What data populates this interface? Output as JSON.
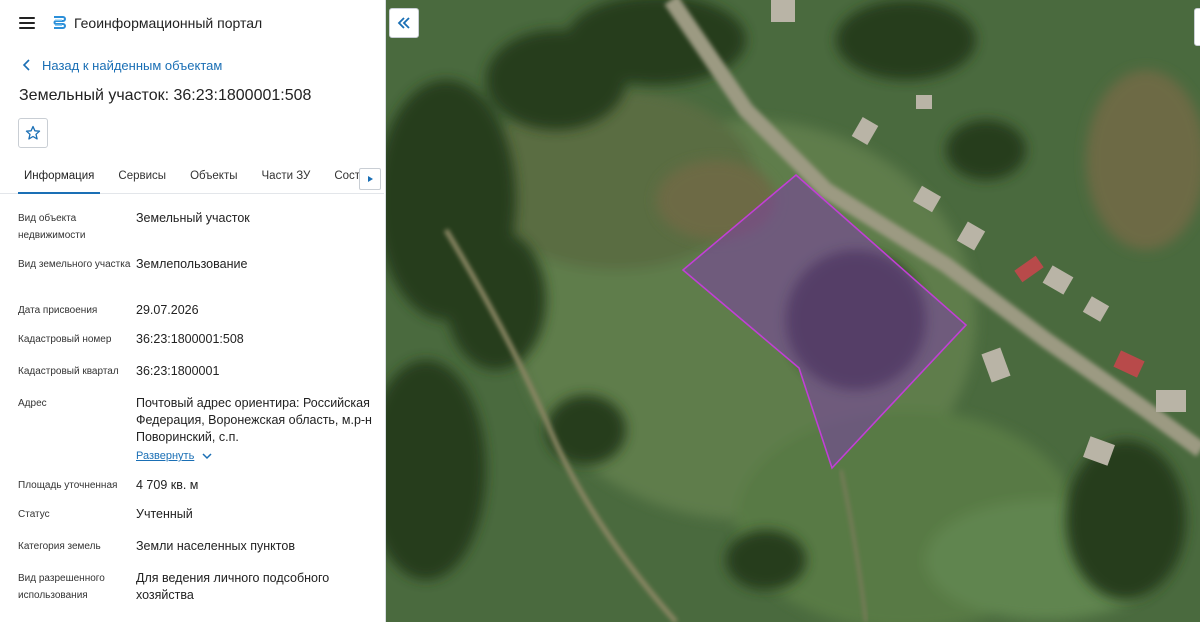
{
  "app": {
    "title": "Геоинформационный портал"
  },
  "nav": {
    "back_label": "Назад к найденным объектам"
  },
  "object": {
    "title": "Земельный участок: 36:23:1800001:508"
  },
  "tabs": [
    {
      "label": "Информация"
    },
    {
      "label": "Сервисы"
    },
    {
      "label": "Объекты"
    },
    {
      "label": "Части ЗУ"
    },
    {
      "label": "Состав"
    }
  ],
  "attributes": [
    {
      "label": "Вид объекта недвижимости",
      "value": "Земельный участок"
    },
    {
      "label": "Вид земельного участка",
      "value": "Землепользование"
    },
    {
      "label": "Дата присвоения",
      "value": "29.07.2026"
    },
    {
      "label": "Кадастровый номер",
      "value": "36:23:1800001:508"
    },
    {
      "label": "Кадастровый квартал",
      "value": "36:23:1800001"
    },
    {
      "label": "Адрес",
      "value": "Почтовый адрес ориентира: Российская Федерация, Воронежская область, м.р-н Поворинский, с.п.",
      "expand_label": "Развернуть"
    },
    {
      "label": "Площадь уточненная",
      "value": "4 709 кв. м"
    },
    {
      "label": "Статус",
      "value": "Учтенный"
    },
    {
      "label": "Категория земель",
      "value": "Земли населенных пунктов"
    },
    {
      "label": "Вид разрешенного использования",
      "value": "Для ведения личного подсобного хозяйства"
    }
  ],
  "colors": {
    "accent": "#1a6fb5",
    "parcel_fill": "#7b3fa6",
    "parcel_stroke": "#c13fd6"
  },
  "icons": {
    "menu": "menu-icon",
    "logo": "portal-logo-icon",
    "back": "chevron-left-icon",
    "favorite": "star-icon",
    "expand": "chevron-down-icon",
    "collapse_panel": "double-chevron-left-icon"
  }
}
